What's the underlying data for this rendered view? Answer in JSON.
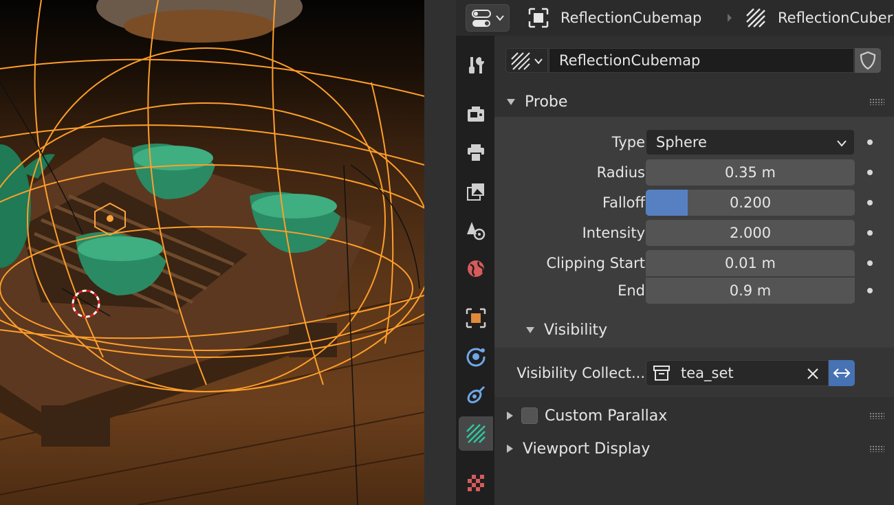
{
  "header": {
    "breadcrumbs": [
      {
        "label": "ReflectionCubemap",
        "icon": "object-icon"
      },
      {
        "label": "ReflectionCuber",
        "icon": "light-probe-icon"
      }
    ]
  },
  "tabs": [
    {
      "name": "tool-tab",
      "icon": "wrench-screwdriver-icon",
      "active": false
    },
    {
      "name": "render-tab",
      "icon": "camera-back-icon",
      "active": false
    },
    {
      "name": "output-tab",
      "icon": "printer-icon",
      "active": false
    },
    {
      "name": "view-layer-tab",
      "icon": "image-stack-icon",
      "active": false
    },
    {
      "name": "scene-tab",
      "icon": "cone-sphere-icon",
      "active": false
    },
    {
      "name": "world-tab",
      "icon": "globe-icon",
      "active": false
    },
    {
      "name": "object-tab",
      "icon": "orange-square-icon",
      "active": false
    },
    {
      "name": "physics-tab",
      "icon": "orbit-icon",
      "active": false
    },
    {
      "name": "constraints-tab",
      "icon": "constraint-icon",
      "active": false
    },
    {
      "name": "data-tab",
      "icon": "light-probe-icon",
      "active": true
    },
    {
      "name": "texture-tab",
      "icon": "checker-icon",
      "active": false
    }
  ],
  "datablock": {
    "name": "ReflectionCubemap"
  },
  "probe": {
    "title": "Probe",
    "type_label": "Type",
    "type_value": "Sphere",
    "radius_label": "Radius",
    "radius_value": "0.35 m",
    "falloff_label": "Falloff",
    "falloff_value": "0.200",
    "falloff_fraction": 0.2,
    "intensity_label": "Intensity",
    "intensity_value": "2.000",
    "clip_start_label": "Clipping Start",
    "clip_start_value": "0.01 m",
    "clip_end_label": "End",
    "clip_end_value": "0.9 m"
  },
  "visibility": {
    "title": "Visibility",
    "collection_label": "Visibility Collect...",
    "collection_value": "tea_set"
  },
  "custom_parallax": {
    "title": "Custom Parallax",
    "enabled": false
  },
  "viewport_display": {
    "title": "Viewport Display"
  },
  "colors": {
    "accent": "#4772b3",
    "falloff_fill": "#5680c2",
    "active_tab_icon": "#2ec7a0",
    "object_icon": "#e08a3c"
  }
}
